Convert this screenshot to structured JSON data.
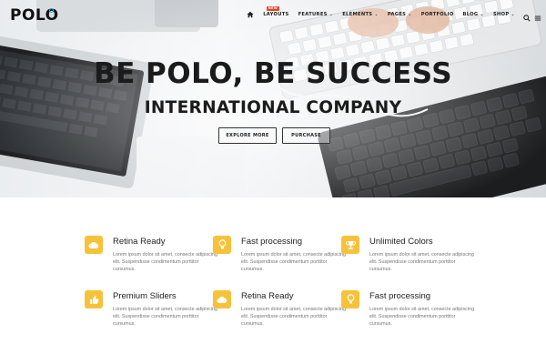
{
  "brand": {
    "logo_text": "POLO"
  },
  "nav": {
    "items": [
      {
        "label": "LAYOUTS",
        "badge": "NEW"
      },
      {
        "label": "FEATURES"
      },
      {
        "label": "ELEMENTS"
      },
      {
        "label": "PAGES"
      },
      {
        "label": "PORTFOLIO"
      },
      {
        "label": "BLOG"
      },
      {
        "label": "SHOP"
      }
    ],
    "icons": [
      "home-icon",
      "search-icon",
      "menu-icon"
    ]
  },
  "hero": {
    "title": "BE POLO, BE SUCCESS",
    "subtitle": "INTERNATIONAL COMPANY",
    "buttons": {
      "explore": "EXPLORE MORE",
      "purchase": "PURCHASE"
    }
  },
  "features": [
    {
      "icon": "cloud-icon",
      "title": "Retina Ready",
      "text": "Lorem ipsum dolor sit amet, consecte adipiscing elit. Suspendisse condimentum porttitor cursumus."
    },
    {
      "icon": "lightbulb-icon",
      "title": "Fast processing",
      "text": "Lorem ipsum dolor sit amet, consecte adipiscing elit. Suspendisse condimentum porttitor cursumus."
    },
    {
      "icon": "trophy-icon",
      "title": "Unlimited Colors",
      "text": "Lorem ipsum dolor sit amet, consecte adipiscing elit. Suspendisse condimentum porttitor cursumus."
    },
    {
      "icon": "thumbs-up-icon",
      "title": "Premium Sliders",
      "text": "Lorem ipsum dolor sit amet, consecte adipiscing elit. Suspendisse condimentum porttitor cursumus."
    },
    {
      "icon": "cloud-icon",
      "title": "Retina Ready",
      "text": "Lorem ipsum dolor sit amet, consecte adipiscing elit. Suspendisse condimentum porttitor cursumus."
    },
    {
      "icon": "lightbulb-icon",
      "title": "Fast processing",
      "text": "Lorem ipsum dolor sit amet, consecte adipiscing elit. Suspendisse condimentum porttitor cursumus."
    }
  ],
  "colors": {
    "accent": "#f7c23a",
    "logo_dot": "#1fa9d6",
    "badge": "#e8432e",
    "text_dark": "#1b1b1b",
    "text_muted": "#777777"
  }
}
